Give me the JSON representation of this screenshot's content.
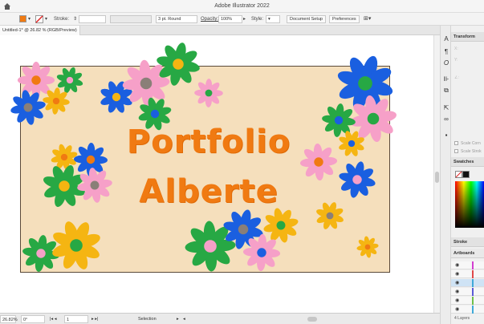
{
  "app": {
    "title": "Adobe Illustrator 2022"
  },
  "control_bar": {
    "stroke_label": "Stroke:",
    "stroke_width": "3 pt. Round",
    "opacity_label": "Opacity:",
    "opacity_value": "100%",
    "style_label": "Style:",
    "document_setup": "Document Setup",
    "preferences": "Preferences"
  },
  "document": {
    "tab_label": "Untitled-1* @ 26.82 % (RGB/Preview)"
  },
  "artwork": {
    "line1": "Portfolio",
    "line2": "Alberte"
  },
  "status_bar": {
    "zoom": "26.82%",
    "rotation": "0°",
    "artboard": "1",
    "tool": "Selection"
  },
  "panels": {
    "transform": "Transform",
    "swatches": "Swatches",
    "stroke": "Stroke",
    "artboards": "Artboards",
    "scale_corners": "Scale Corn",
    "scale_strokes": "Scale Strok",
    "layers_count": "4 Layers",
    "layer_colors": [
      "#d33fd0",
      "#e04a4a",
      "#3fa9d8",
      "#5b5bd6",
      "#6fbf4a",
      "#3fa9d8"
    ]
  },
  "colors": {
    "artboard": "#f5dfbc",
    "text": "#f07a12"
  }
}
